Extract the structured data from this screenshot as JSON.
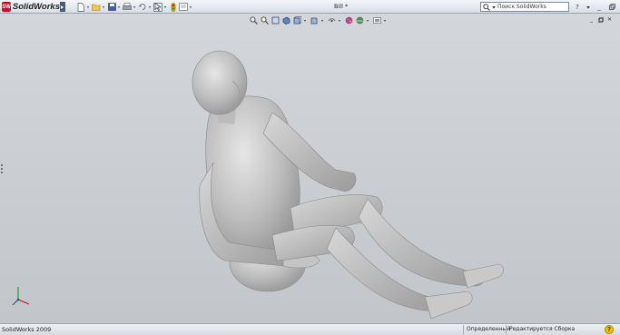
{
  "app": {
    "logo_text": "SolidWorks",
    "logo_mark": "SW",
    "document_title": "Bill *"
  },
  "search": {
    "placeholder": "Поиск SolidWorks"
  },
  "status_bar": {
    "version": "SolidWorks 2009",
    "state": "Определенный",
    "mode": "Редактируется Сборка"
  },
  "icons": {
    "main_toolbar": [
      "new-document-icon",
      "open-icon",
      "save-icon",
      "print-icon",
      "undo-icon",
      "select-icon",
      "rebuild-icon",
      "options-icon"
    ],
    "view_toolbar": [
      "zoom-to-fit-icon",
      "zoom-area-icon",
      "previous-view-icon",
      "section-view-icon",
      "view-orientation-icon",
      "display-style-icon",
      "hide-show-icon",
      "edit-appearance-icon",
      "apply-scene-icon",
      "view-settings-icon"
    ]
  },
  "colors": {
    "viewport_top": "#d3d6da",
    "viewport_bottom": "#c2c6cb",
    "model_gray": "#b9b9b9",
    "brand_red": "#c8102e"
  }
}
